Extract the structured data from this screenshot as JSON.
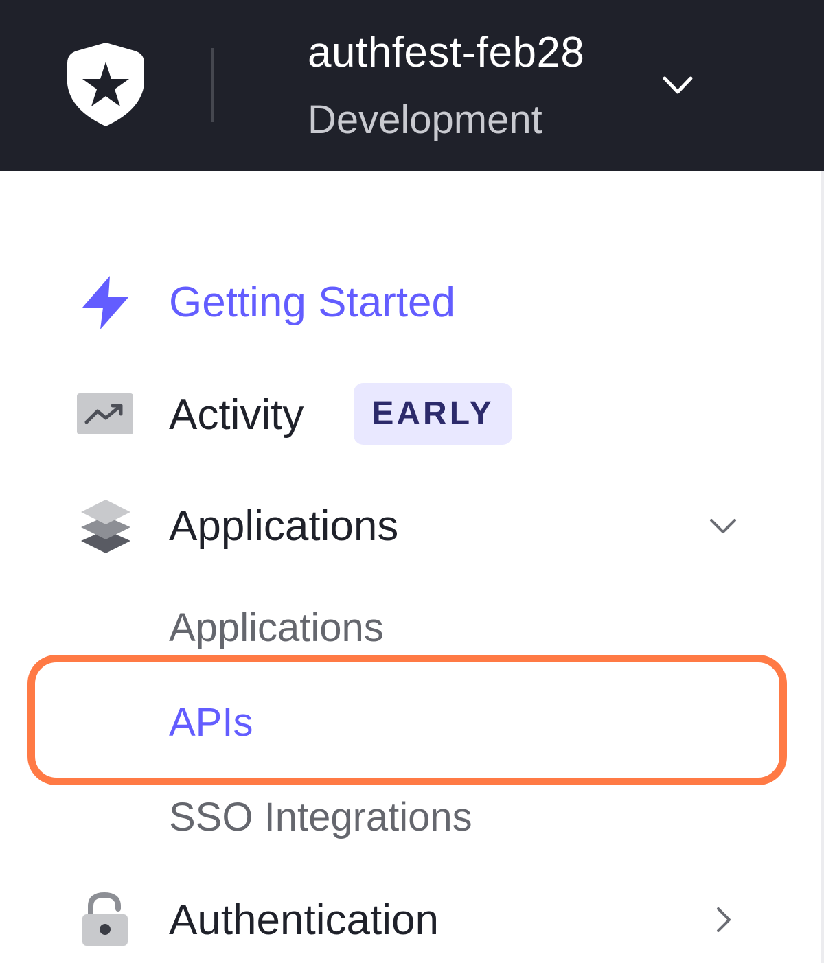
{
  "header": {
    "tenant_name": "authfest-feb28",
    "environment": "Development",
    "logo_icon": "auth0-shield-star-logo",
    "switcher_icon": "chevron-down-icon"
  },
  "nav": {
    "getting_started": {
      "label": "Getting Started",
      "icon": "lightning-bolt-icon",
      "active": true
    },
    "activity": {
      "label": "Activity",
      "icon": "trending-chart-icon",
      "badge": "EARLY"
    },
    "applications": {
      "label": "Applications",
      "icon": "layers-stack-icon",
      "expanded": true,
      "children": [
        {
          "label": "Applications"
        },
        {
          "label": "APIs",
          "active": true,
          "highlighted": true
        },
        {
          "label": "SSO Integrations"
        }
      ]
    },
    "authentication": {
      "label": "Authentication",
      "icon": "unlock-icon",
      "expanded": false
    }
  },
  "colors": {
    "header_bg": "#1f212a",
    "accent": "#635dff",
    "highlight_outline": "#ff7a45",
    "badge_bg": "#e9e8ff"
  }
}
